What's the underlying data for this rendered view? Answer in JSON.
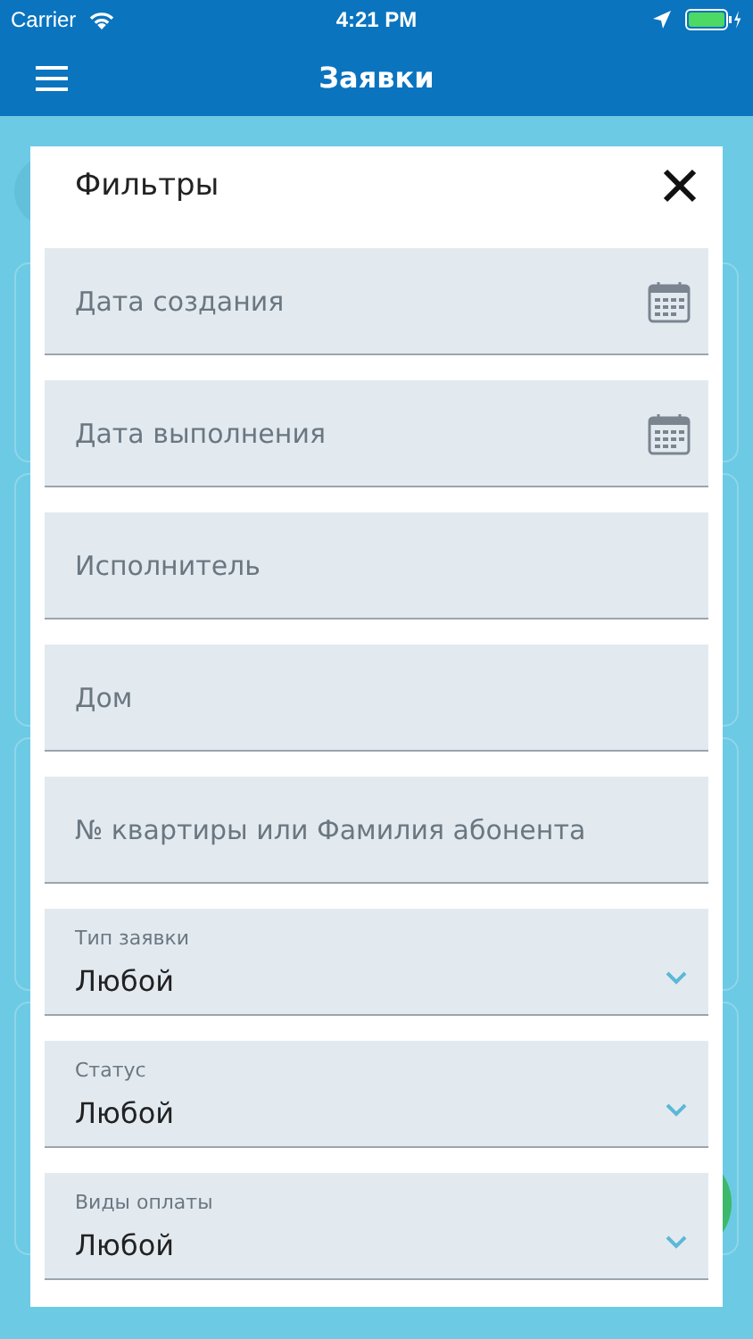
{
  "status_bar": {
    "carrier": "Carrier",
    "time": "4:21 PM"
  },
  "nav_bar": {
    "title": "Заявки"
  },
  "filters": {
    "title": "Фильтры",
    "fields": [
      {
        "kind": "date",
        "placeholder": "Дата создания"
      },
      {
        "kind": "date",
        "placeholder": "Дата выполнения"
      },
      {
        "kind": "text",
        "placeholder": "Исполнитель"
      },
      {
        "kind": "text",
        "placeholder": "Дом"
      },
      {
        "kind": "text",
        "placeholder": "№ квартиры или Фамилия абонента"
      },
      {
        "kind": "select",
        "label": "Тип заявки",
        "value": "Любой"
      },
      {
        "kind": "select",
        "label": "Статус",
        "value": "Любой"
      },
      {
        "kind": "select",
        "label": "Виды оплаты",
        "value": "Любой"
      }
    ]
  }
}
